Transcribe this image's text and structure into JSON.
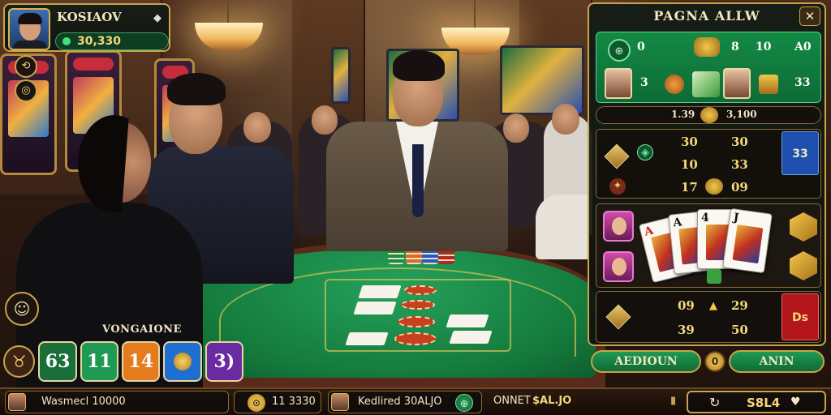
{
  "player": {
    "name": "KOSIAOV",
    "cash": "30,330",
    "diamond_icon": "diamond-icon"
  },
  "side_buttons": [
    "⟲",
    "◎"
  ],
  "chat": {
    "icon": "chat-icon"
  },
  "bet_panel": {
    "title": "VONGAIONE",
    "chips": [
      {
        "label": "63",
        "color": "#1a6e3a"
      },
      {
        "label": "11",
        "color": "#1f9a54"
      },
      {
        "label": "14",
        "color": "#e47b1e"
      },
      {
        "label": "",
        "color": "#1e6fd0"
      },
      {
        "label": "3)",
        "color": "#6a2aa0"
      }
    ]
  },
  "bottom_bar": {
    "left_text": "Wasmecl 10000",
    "coin_text": "11 3330",
    "middle_text": "Kedlired 30ALJO",
    "onnet_label": "ONNET",
    "onnet_value": "$AL.JO",
    "balance": "S8L4"
  },
  "right_panel": {
    "title": "PAGNA ALLW",
    "close_label": "✕",
    "top_grid": {
      "row1": [
        "0",
        "8",
        "10",
        "A0"
      ],
      "row2": [
        "3",
        "",
        "",
        "33"
      ]
    },
    "pot_bar": {
      "left": "1.39",
      "right": "3,100"
    },
    "rows": [
      {
        "a": "30",
        "b": "30",
        "side": "33"
      },
      {
        "a": "10",
        "b": "33",
        "side": ""
      },
      {
        "a": "17",
        "b": "09",
        "side": ""
      }
    ],
    "cards": [
      "A",
      "A",
      "4",
      "J"
    ],
    "lower_row": {
      "a": "09",
      "b": "29",
      "a2": "39",
      "b2": "50",
      "side": "Ds"
    },
    "actions": {
      "left": "AEDIOUN",
      "right": "ANIN",
      "coin": "0"
    }
  }
}
